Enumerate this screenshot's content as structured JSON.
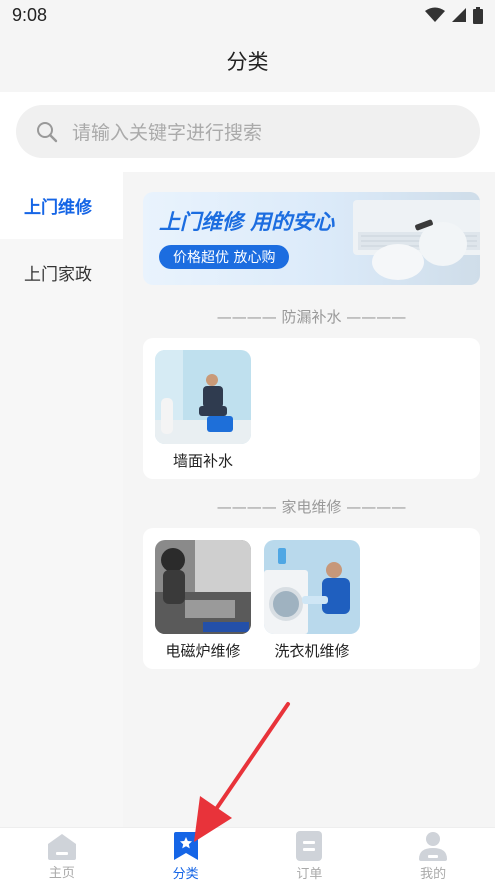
{
  "status_bar": {
    "time": "9:08"
  },
  "header": {
    "title": "分类"
  },
  "search": {
    "placeholder": "请输入关键字进行搜索"
  },
  "sidebar": {
    "items": [
      {
        "label": "上门维修",
        "active": true
      },
      {
        "label": "上门家政",
        "active": false
      }
    ]
  },
  "banner": {
    "title": "上门维修 用的安心",
    "tagline": "价格超优 放心购"
  },
  "sections": [
    {
      "title": "———— 防漏补水 ————",
      "items": [
        {
          "label": "墙面补水",
          "image": "wall-repair-photo"
        }
      ]
    },
    {
      "title": "———— 家电维修 ————",
      "items": [
        {
          "label": "电磁炉维修",
          "image": "induction-cooker-repair-photo"
        },
        {
          "label": "洗衣机维修",
          "image": "washing-machine-repair-photo"
        }
      ]
    }
  ],
  "tabbar": {
    "tabs": [
      {
        "label": "主页",
        "icon": "home-icon",
        "active": false
      },
      {
        "label": "分类",
        "icon": "category-icon",
        "active": true
      },
      {
        "label": "订单",
        "icon": "orders-icon",
        "active": false
      },
      {
        "label": "我的",
        "icon": "profile-icon",
        "active": false
      }
    ]
  },
  "colors": {
    "accent": "#1565e6",
    "annotation_arrow": "#e8333a"
  }
}
